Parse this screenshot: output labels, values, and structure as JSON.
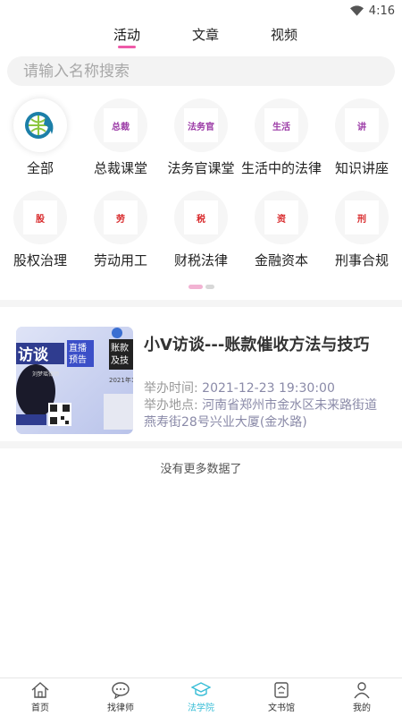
{
  "status_bar": {
    "time": "4:16"
  },
  "tabs": [
    {
      "label": "活动",
      "active": true
    },
    {
      "label": "文章",
      "active": false
    },
    {
      "label": "视频",
      "active": false
    }
  ],
  "search": {
    "placeholder": "请输入名称搜索"
  },
  "categories": [
    {
      "label": "全部",
      "icon": "globe-icon",
      "char": ""
    },
    {
      "label": "总裁课堂",
      "icon": "president-class-icon",
      "char": "总裁",
      "color": "#9b3aa6"
    },
    {
      "label": "法务官课堂",
      "icon": "legal-officer-class-icon",
      "char": "法务官",
      "color": "#9b3aa6"
    },
    {
      "label": "生活中的法律",
      "icon": "life-law-icon",
      "char": "生活",
      "color": "#9b3aa6"
    },
    {
      "label": "知识讲座",
      "icon": "lecture-icon",
      "char": "讲",
      "color": "#9b3aa6"
    },
    {
      "label": "股权治理",
      "icon": "equity-icon",
      "char": "股",
      "color": "#d8282a"
    },
    {
      "label": "劳动用工",
      "icon": "labor-icon",
      "char": "劳",
      "color": "#d8282a"
    },
    {
      "label": "财税法律",
      "icon": "tax-icon",
      "char": "税",
      "color": "#d8282a"
    },
    {
      "label": "金融资本",
      "icon": "finance-icon",
      "char": "资",
      "color": "#d8282a"
    },
    {
      "label": "刑事合规",
      "icon": "criminal-icon",
      "char": "刑",
      "color": "#d8282a"
    }
  ],
  "activity": {
    "title": "小V访谈---账款催收方法与技巧",
    "time_label": "举办时间:",
    "time_value": "2021-12-23 19:30:00",
    "place_label": "举办地点:",
    "place_value": "河南省郑州市金水区未来路街道燕寿街28号兴业大厦(金水路)",
    "thumb": {
      "t1": "访谈",
      "t2": "直播",
      "t3": "预告",
      "t4": "账款",
      "t5": "及技",
      "t6": "2021年12",
      "t7": "刘梦瑶律师"
    }
  },
  "list_end_text": "没有更多数据了",
  "nav": [
    {
      "label": "首页",
      "icon": "home-icon",
      "active": false
    },
    {
      "label": "找律师",
      "icon": "chat-icon",
      "active": false
    },
    {
      "label": "法学院",
      "icon": "graduation-cap-icon",
      "active": true
    },
    {
      "label": "文书馆",
      "icon": "document-box-icon",
      "active": false
    },
    {
      "label": "我的",
      "icon": "user-icon",
      "active": false
    }
  ],
  "colors": {
    "accent": "#ee5aa8",
    "nav_active": "#37bdd6"
  }
}
